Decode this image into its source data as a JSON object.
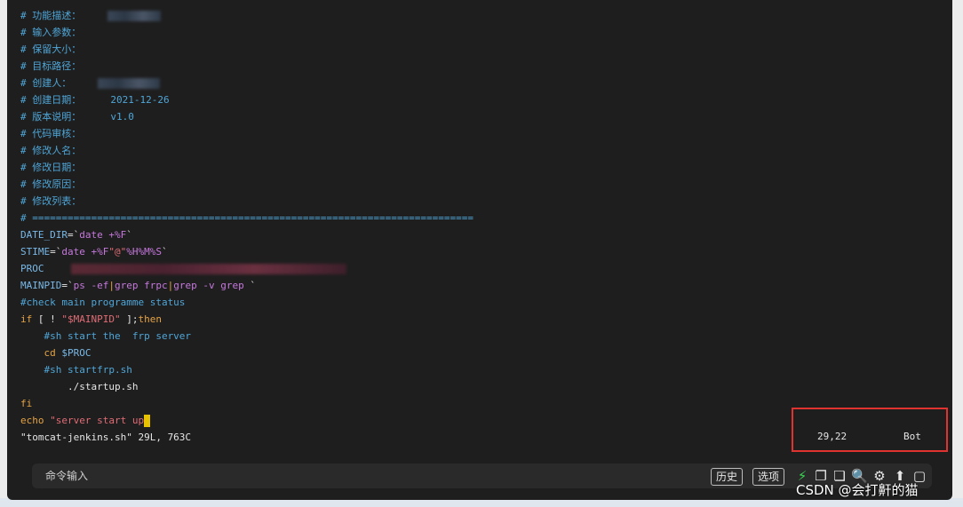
{
  "code_lines": [
    {
      "segments": [
        {
          "t": "# 功能描述：",
          "c": "c-comment"
        }
      ],
      "blur": {
        "w": 60,
        "red": false
      }
    },
    {
      "segments": [
        {
          "t": "# 输入参数：",
          "c": "c-comment"
        }
      ]
    },
    {
      "segments": [
        {
          "t": "# 保留大小：",
          "c": "c-comment"
        }
      ]
    },
    {
      "segments": [
        {
          "t": "# 目标路径：",
          "c": "c-comment"
        }
      ]
    },
    {
      "segments": [
        {
          "t": "# 创建人：",
          "c": "c-comment"
        }
      ],
      "blur": {
        "w": 70,
        "red": false
      }
    },
    {
      "segments": [
        {
          "t": "# 创建日期：     2021-12-26",
          "c": "c-comment"
        }
      ]
    },
    {
      "segments": [
        {
          "t": "# 版本说明：     v1.0",
          "c": "c-comment"
        }
      ]
    },
    {
      "segments": [
        {
          "t": "# 代码审核：",
          "c": "c-comment"
        }
      ]
    },
    {
      "segments": [
        {
          "t": "# 修改人名：",
          "c": "c-comment"
        }
      ]
    },
    {
      "segments": [
        {
          "t": "# 修改日期：",
          "c": "c-comment"
        }
      ]
    },
    {
      "segments": [
        {
          "t": "# 修改原因：",
          "c": "c-comment"
        }
      ]
    },
    {
      "segments": [
        {
          "t": "# 修改列表：",
          "c": "c-comment"
        }
      ]
    },
    {
      "segments": [
        {
          "t": "# ===========================================================================",
          "c": "c-comment"
        }
      ]
    },
    {
      "segments": [
        {
          "t": "DATE_DIR",
          "c": "c-var"
        },
        {
          "t": "=`",
          "c": "c-white"
        },
        {
          "t": "date +%F",
          "c": "c-purple"
        },
        {
          "t": "`",
          "c": "c-white"
        }
      ]
    },
    {
      "segments": [
        {
          "t": "STIME",
          "c": "c-var"
        },
        {
          "t": "=`",
          "c": "c-white"
        },
        {
          "t": "date +%F",
          "c": "c-purple"
        },
        {
          "t": "\"@\"",
          "c": "c-red"
        },
        {
          "t": "%H%M%S",
          "c": "c-purple"
        },
        {
          "t": "`",
          "c": "c-white"
        }
      ]
    },
    {
      "segments": [
        {
          "t": "PROC",
          "c": "c-var"
        }
      ],
      "blur": {
        "w": 310,
        "red": true
      }
    },
    {
      "segments": [
        {
          "t": "MAINPID",
          "c": "c-var"
        },
        {
          "t": "=`",
          "c": "c-white"
        },
        {
          "t": "ps -ef",
          "c": "c-purple"
        },
        {
          "t": "|",
          "c": "c-orange"
        },
        {
          "t": "grep frpc",
          "c": "c-purple"
        },
        {
          "t": "|",
          "c": "c-orange"
        },
        {
          "t": "grep -v grep",
          "c": "c-purple"
        },
        {
          "t": " `",
          "c": "c-white"
        }
      ]
    },
    {
      "segments": [
        {
          "t": "#check main programme status",
          "c": "c-comment"
        }
      ]
    },
    {
      "segments": [
        {
          "t": "if",
          "c": "c-orange"
        },
        {
          "t": " [ ! ",
          "c": "c-white"
        },
        {
          "t": "\"$MAINPID\"",
          "c": "c-red"
        },
        {
          "t": " ];",
          "c": "c-white"
        },
        {
          "t": "then",
          "c": "c-orange"
        }
      ]
    },
    {
      "segments": [
        {
          "t": "    #sh start the  frp server",
          "c": "c-comment"
        }
      ]
    },
    {
      "segments": [
        {
          "t": "    cd ",
          "c": "c-orange"
        },
        {
          "t": "$PROC",
          "c": "c-var"
        }
      ]
    },
    {
      "segments": [
        {
          "t": "    #sh startfrp.sh",
          "c": "c-comment"
        }
      ]
    },
    {
      "segments": [
        {
          "t": "        ./startup.sh",
          "c": "c-white"
        }
      ]
    },
    {
      "segments": [
        {
          "t": "fi",
          "c": "c-orange"
        }
      ]
    },
    {
      "segments": [
        {
          "t": "echo ",
          "c": "c-orange"
        },
        {
          "t": "\"server start up",
          "c": "c-red"
        }
      ],
      "cursor": true
    },
    {
      "segments": [
        {
          "t": "\"tomcat-jenkins.sh\" 29L, 763C",
          "c": "c-white"
        }
      ]
    }
  ],
  "status": {
    "position": "29,22",
    "scroll": "Bot"
  },
  "cmdbar": {
    "placeholder": "命令输入",
    "history_label": "历史",
    "options_label": "选项",
    "icons": {
      "lightning": "⚡",
      "copy": "❐",
      "paste": "❏",
      "search": "🔍",
      "gear": "⚙",
      "upload": "⬆",
      "window": "▢"
    }
  },
  "watermark": "CSDN @会打鼾的猫"
}
